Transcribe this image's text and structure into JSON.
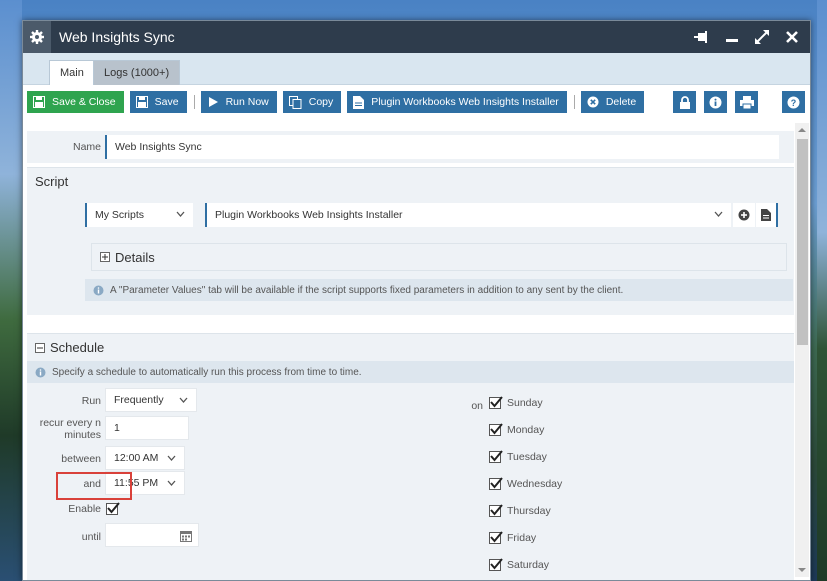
{
  "window": {
    "title": "Web Insights Sync"
  },
  "tabs": [
    {
      "label": "Main",
      "active": true
    },
    {
      "label": "Logs (1000+)",
      "active": false
    }
  ],
  "toolbar": {
    "save_close": "Save & Close",
    "save": "Save",
    "run_now": "Run Now",
    "copy": "Copy",
    "installer": "Plugin Workbooks Web Insights Installer",
    "delete": "Delete"
  },
  "name_field": {
    "label": "Name",
    "value": "Web Insights Sync"
  },
  "script": {
    "heading": "Script",
    "category": "My Scripts",
    "script_name": "Plugin Workbooks Web Insights Installer",
    "details": "Details",
    "info": "A \"Parameter Values\" tab will be available if the script supports fixed parameters in addition to any sent by the client."
  },
  "schedule": {
    "heading": "Schedule",
    "info": "Specify a schedule to automatically run this process from time to time.",
    "run_label": "Run",
    "run_value": "Frequently",
    "recur_label_1": "recur every n",
    "recur_label_2": "minutes",
    "recur_value": "1",
    "between_label": "between",
    "between_value": "12:00 AM",
    "and_label": "and",
    "and_value": "11:55 PM",
    "enable_label": "Enable",
    "until_label": "until",
    "until_value": "",
    "on_label": "on",
    "days": [
      "Sunday",
      "Monday",
      "Tuesday",
      "Wednesday",
      "Thursday",
      "Friday",
      "Saturday"
    ]
  },
  "colors": {
    "accent": "#2f6fa3",
    "green": "#2fa44f",
    "titlebar": "#2e3c4c",
    "highlight": "#d9413a"
  }
}
